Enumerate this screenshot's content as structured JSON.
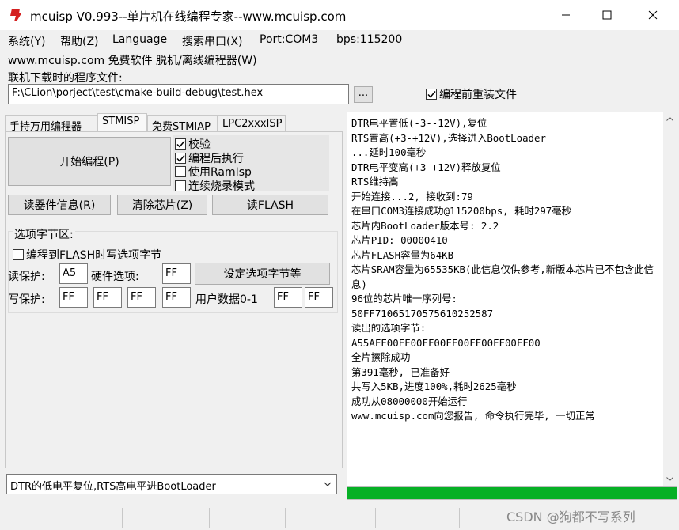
{
  "window": {
    "title": "mcuisp V0.993--单片机在线编程专家--www.mcuisp.com",
    "icon": "mcuisp-app-icon"
  },
  "menu": {
    "system": "系统(Y)",
    "help": "帮助(Z)",
    "language": "Language",
    "search_port": "搜索串口(X)",
    "port": "Port:COM3",
    "bps": "bps:115200",
    "line2": "www.mcuisp.com 免费软件 脱机/离线编程器(W)"
  },
  "file": {
    "label": "联机下载时的程序文件:",
    "path": "F:\\CLion\\porject\\test\\cmake-build-debug\\test.hex",
    "browse": "...",
    "reload_label": "编程前重装文件",
    "reload_checked": true
  },
  "tabs": [
    "手持万用编程器",
    "STMISP",
    "免费STMIAP",
    "LPC2xxxISP"
  ],
  "active_tab": 1,
  "program": {
    "start_button": "开始编程(P)",
    "options": [
      {
        "label": "校验",
        "checked": true
      },
      {
        "label": "编程后执行",
        "checked": true
      },
      {
        "label": "使用RamIsp",
        "checked": false
      },
      {
        "label": "连续烧录模式",
        "checked": false
      }
    ],
    "read_info": "读器件信息(R)",
    "erase_chip": "清除芯片(Z)",
    "read_flash": "读FLASH"
  },
  "option_bytes": {
    "group_title": "选项字节区:",
    "write_when_flash": "编程到FLASH时写选项字节",
    "write_when_flash_checked": false,
    "read_protect_label": "读保护:",
    "read_protect": "A5",
    "hw_option_label": "硬件选项:",
    "hw_option": "FF",
    "set_button": "设定选项字节等",
    "write_protect_label": "写保护:",
    "write_protect": [
      "FF",
      "FF",
      "FF",
      "FF"
    ],
    "user_data_label": "用户数据0-1",
    "user_data": [
      "FF",
      "FF"
    ]
  },
  "mode_combo": "DTR的低电平复位,RTS高电平进BootLoader",
  "log": [
    "DTR电平置低(-3--12V),复位",
    "RTS置高(+3-+12V),选择进入BootLoader",
    "...延时100毫秒",
    "DTR电平变高(+3-+12V)释放复位",
    "RTS维持高",
    "开始连接...2, 接收到:79",
    "在串口COM3连接成功@115200bps, 耗时297毫秒",
    "芯片内BootLoader版本号: 2.2",
    "芯片PID: 00000410",
    "芯片FLASH容量为64KB",
    "芯片SRAM容量为65535KB(此信息仅供参考,新版本芯片已不包含此信息)",
    "96位的芯片唯一序列号:",
    "50FF71065170575610252587",
    "读出的选项字节:",
    "A55AFF00FF00FF00FF00FF00FF00FF00",
    "全片擦除成功",
    "第391毫秒, 已准备好",
    "共写入5KB,进度100%,耗时2625毫秒",
    "成功从08000000开始运行",
    "www.mcuisp.com向您报告, 命令执行完毕, 一切正常"
  ],
  "progress": 1.0,
  "watermark": "CSDN @狗都不写系列"
}
